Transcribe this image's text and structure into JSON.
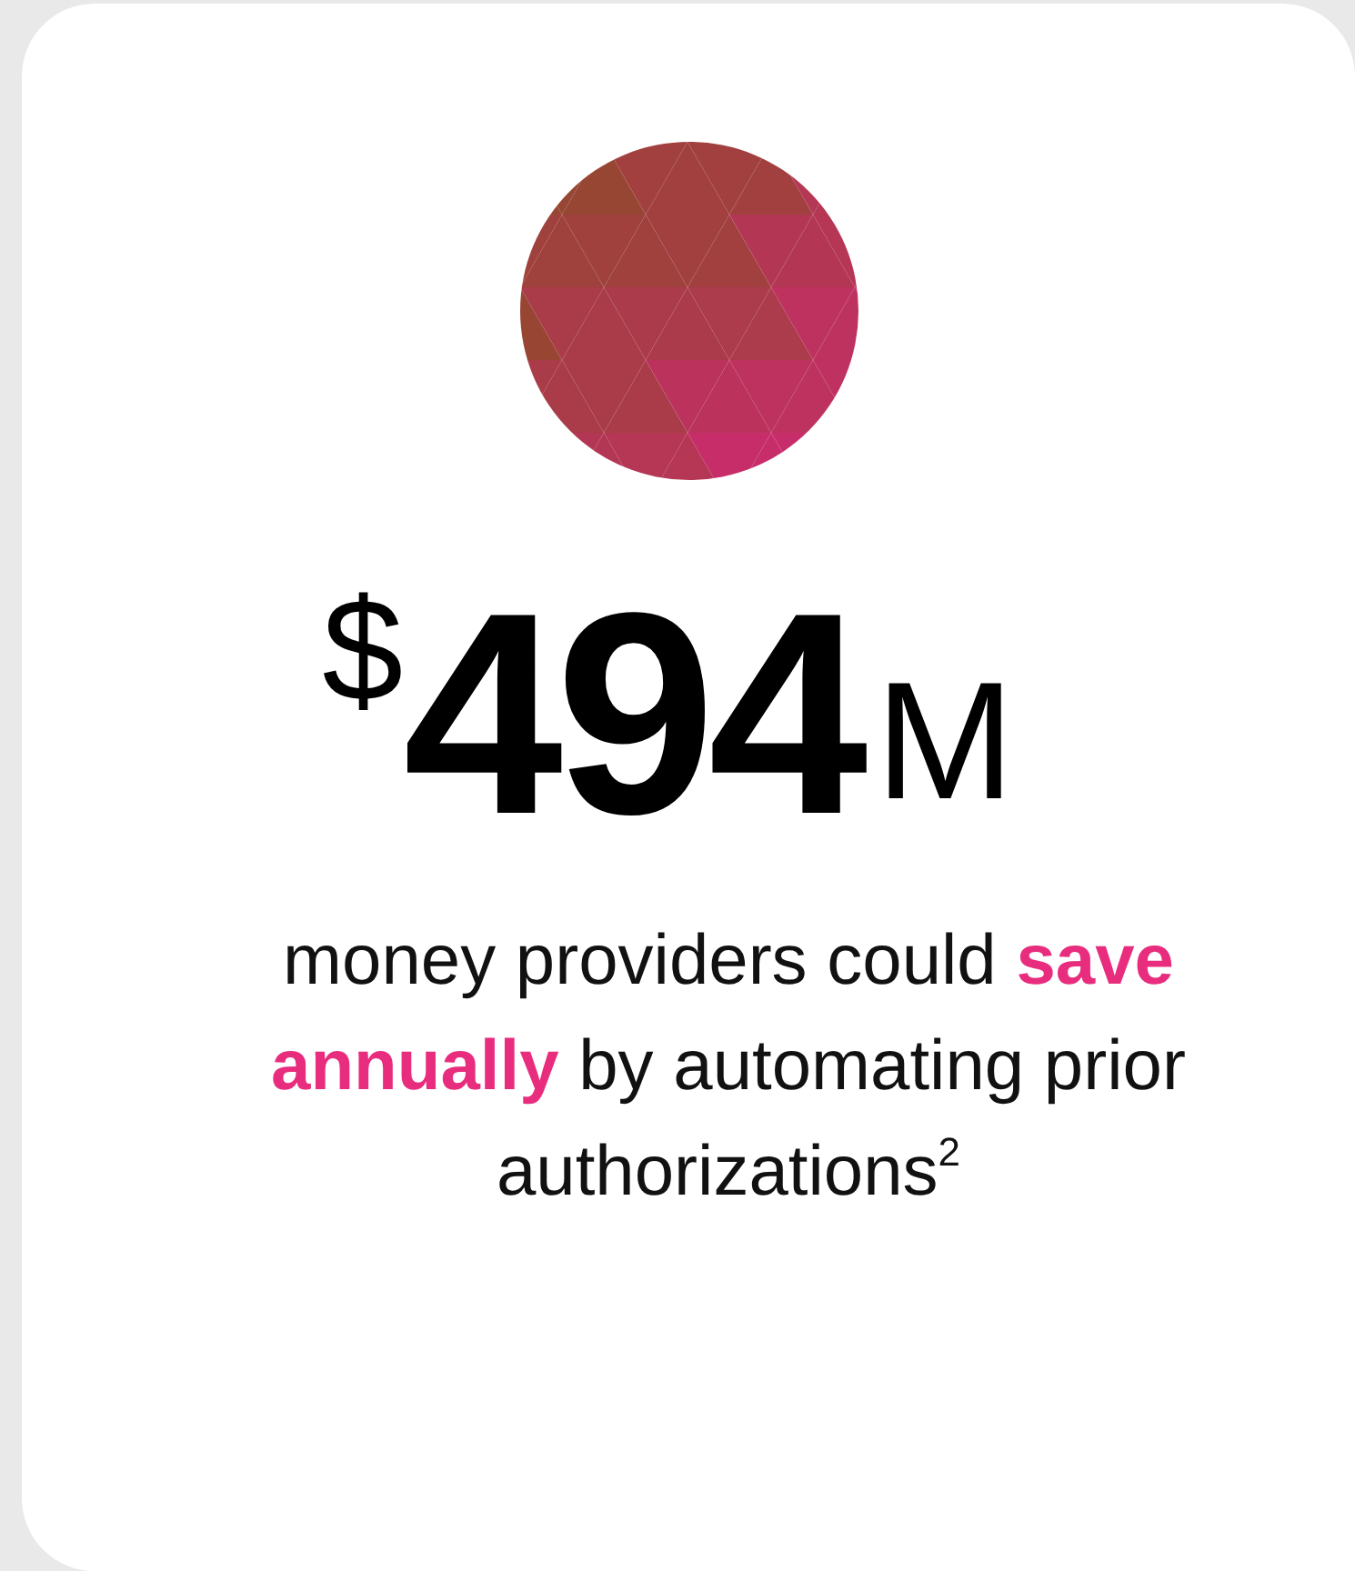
{
  "stat": {
    "prefix": "$",
    "value": "494",
    "suffix": "M"
  },
  "description": "money providers could **save annually** by automating prior authorizations$^{2}$"
}
